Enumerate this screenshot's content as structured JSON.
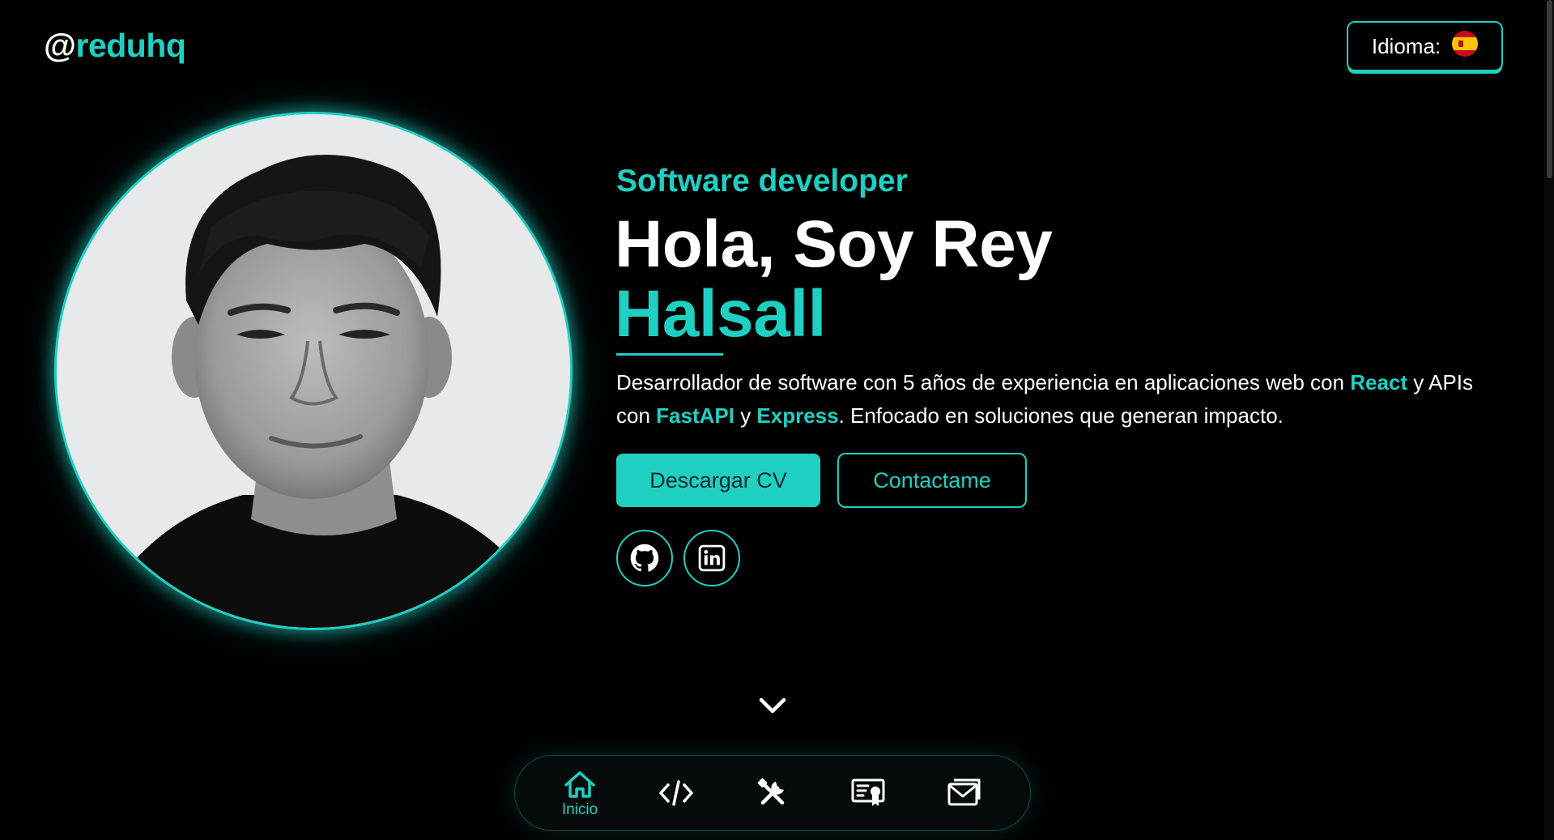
{
  "header": {
    "logo_at": "@",
    "logo_handle": "reduhq",
    "language_label": "Idioma:",
    "language_flag_icon": "spain-flag-icon"
  },
  "hero": {
    "role": "Software developer",
    "greeting": "Hola, Soy Rey",
    "surname": "Halsall",
    "description": {
      "part1": "Desarrollador de software con 5 años de experiencia en aplicaciones web con ",
      "react": "React",
      "part2": " y APIs con ",
      "fastapi": "FastAPI",
      "part3": " y ",
      "express": "Express",
      "part4": ". Enfocado en soluciones que generan impacto."
    },
    "primary_button": "Descargar CV",
    "secondary_button": "Contactame",
    "socials": [
      {
        "name": "github",
        "icon": "github-icon"
      },
      {
        "name": "linkedin",
        "icon": "linkedin-icon"
      }
    ],
    "scroll_icon": "chevron-down-icon"
  },
  "bottom_nav": {
    "items": [
      {
        "icon": "home-icon",
        "label": "Inicio",
        "active": true
      },
      {
        "icon": "code-icon",
        "label": "",
        "active": false
      },
      {
        "icon": "tools-icon",
        "label": "",
        "active": false
      },
      {
        "icon": "certificate-icon",
        "label": "",
        "active": false
      },
      {
        "icon": "mail-icon",
        "label": "",
        "active": false
      }
    ]
  },
  "colors": {
    "accent": "#1fcfc2",
    "background": "#000000",
    "text": "#ffffff"
  }
}
